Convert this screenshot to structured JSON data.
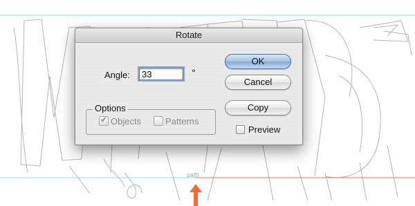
{
  "canvas": {
    "path_label": "path",
    "guide_color": "#7fe3ee",
    "smart_guide_color": "#ff6a55",
    "arrow_color": "#ff6a2a"
  },
  "dialog": {
    "title": "Rotate",
    "angle_label": "Angle:",
    "angle_value": "33",
    "degree_symbol": "°",
    "options_legend": "Options",
    "objects_label": "Objects",
    "objects_checked": true,
    "patterns_label": "Patterns",
    "patterns_checked": false,
    "preview_label": "Preview",
    "preview_checked": false,
    "buttons": {
      "ok": "OK",
      "cancel": "Cancel",
      "copy": "Copy"
    }
  }
}
